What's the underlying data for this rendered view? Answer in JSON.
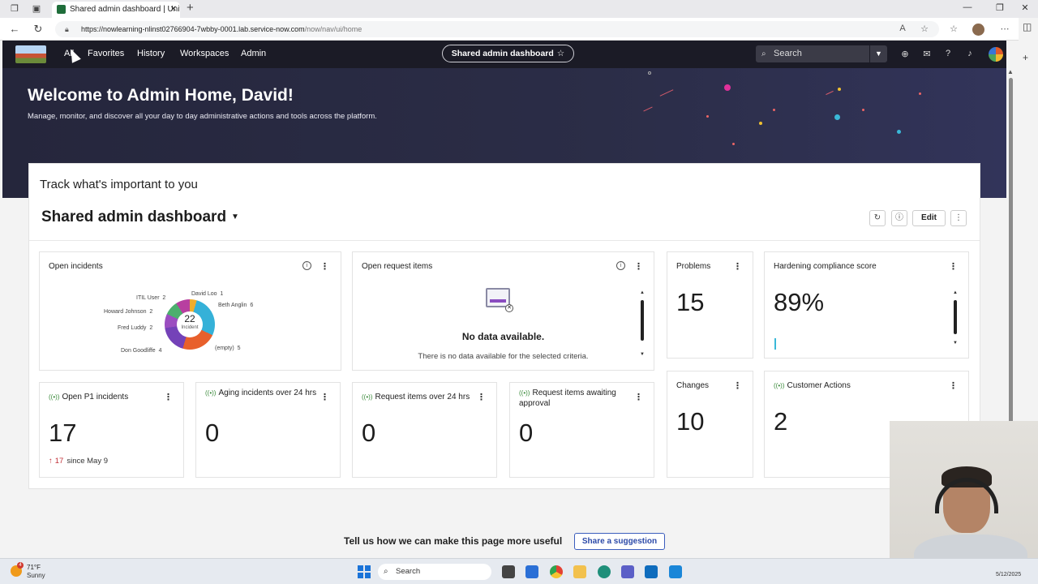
{
  "browser": {
    "tab_title": "Shared admin dashboard | Unifie",
    "url_host": "https://nowlearning-nlinst02766904-7wbby-0001.lab.service-now.com",
    "url_path": "/now/nav/ui/home"
  },
  "header": {
    "nav": [
      "All",
      "Favorites",
      "History",
      "Workspaces",
      "Admin"
    ],
    "pill_label": "Shared admin dashboard",
    "search_placeholder": "Search"
  },
  "hero": {
    "title": "Welcome to Admin Home, David!",
    "subtitle": "Manage, monitor, and discover all your day to day administrative actions and tools across the platform."
  },
  "panel": {
    "heading": "Track what's important to you",
    "dashboard_title": "Shared admin dashboard",
    "edit_label": "Edit"
  },
  "cards": {
    "open_incidents": {
      "title": "Open incidents",
      "total": "22",
      "center_label": "Incident",
      "segments": [
        {
          "label": "David Loo",
          "value": "1",
          "color": "#f0ad2c"
        },
        {
          "label": "Beth Anglin",
          "value": "6",
          "color": "#35b1d8"
        },
        {
          "label": "(empty)",
          "value": "5",
          "color": "#e8602c"
        },
        {
          "label": "Don Goodliffe",
          "value": "4",
          "color": "#7442b8"
        },
        {
          "label": "Fred Luddy",
          "value": "2",
          "color": "#9b4ec0"
        },
        {
          "label": "Howard Johnson",
          "value": "2",
          "color": "#4caf6e"
        },
        {
          "label": "ITIL User",
          "value": "2",
          "color": "#b83fa0"
        }
      ]
    },
    "open_request_items": {
      "title": "Open request items",
      "nodata_title": "No data available.",
      "nodata_text": "There is no data available for the selected criteria."
    },
    "problems": {
      "title": "Problems",
      "value": "15"
    },
    "hardening": {
      "title": "Hardening compliance score",
      "value": "89%"
    },
    "changes": {
      "title": "Changes",
      "value": "10"
    },
    "customer_actions": {
      "title": "Customer Actions",
      "value": "2"
    },
    "open_p1": {
      "title": "Open P1 incidents",
      "value": "17",
      "trend_value": "17",
      "trend_text": "since May 9"
    },
    "aging_incidents": {
      "title": "Aging incidents over 24 hrs",
      "value": "0"
    },
    "request_items_24": {
      "title": "Request items over 24 hrs",
      "value": "0"
    },
    "request_awaiting": {
      "title": "Request items awaiting approval",
      "value": "0"
    }
  },
  "footer": {
    "text": "Tell us how we can make this page more useful",
    "button": "Share a suggestion"
  },
  "taskbar": {
    "temp": "71°F",
    "condition": "Sunny",
    "weather_badge": "4",
    "search": "Search",
    "date": "5/12/2025"
  }
}
